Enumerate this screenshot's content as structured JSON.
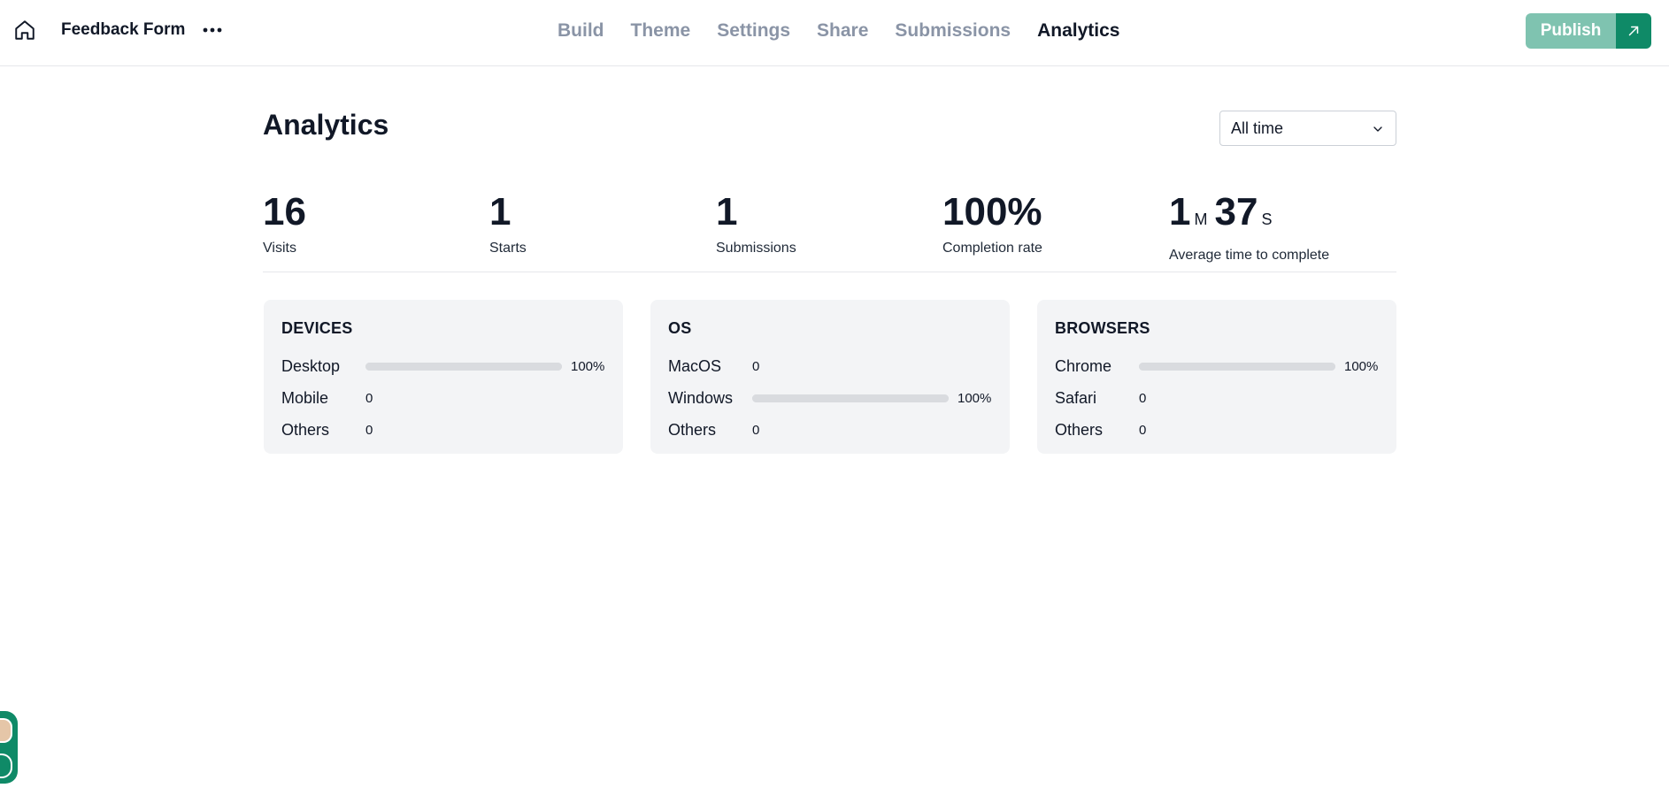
{
  "header": {
    "form_title": "Feedback Form",
    "tabs": [
      {
        "label": "Build",
        "active": false
      },
      {
        "label": "Theme",
        "active": false
      },
      {
        "label": "Settings",
        "active": false
      },
      {
        "label": "Share",
        "active": false
      },
      {
        "label": "Submissions",
        "active": false
      },
      {
        "label": "Analytics",
        "active": true
      }
    ],
    "publish_label": "Publish",
    "icons": {
      "home": "home-icon",
      "more": "more-horizontal-icon",
      "external": "arrow-up-right-icon"
    }
  },
  "main": {
    "title": "Analytics",
    "period": {
      "selected": "All time",
      "icon": "chevron-down-icon"
    },
    "stats": [
      {
        "value": "16",
        "label": "Visits"
      },
      {
        "value": "1",
        "label": "Starts"
      },
      {
        "value": "1",
        "label": "Submissions"
      },
      {
        "value": "100%",
        "label": "Completion rate"
      },
      {
        "minutes": "1",
        "minutes_unit": "M",
        "seconds": "37",
        "seconds_unit": "S",
        "label": "Average time to complete"
      }
    ],
    "cards": [
      {
        "title": "DEVICES",
        "rows": [
          {
            "label": "Desktop",
            "value": "100%",
            "fraction": 1.0
          },
          {
            "label": "Mobile",
            "value": "0",
            "fraction": 0
          },
          {
            "label": "Others",
            "value": "0",
            "fraction": 0
          }
        ]
      },
      {
        "title": "OS",
        "rows": [
          {
            "label": "MacOS",
            "value": "0",
            "fraction": 0
          },
          {
            "label": "Windows",
            "value": "100%",
            "fraction": 1.0
          },
          {
            "label": "Others",
            "value": "0",
            "fraction": 0
          }
        ]
      },
      {
        "title": "BROWSERS",
        "rows": [
          {
            "label": "Chrome",
            "value": "100%",
            "fraction": 1.0
          },
          {
            "label": "Safari",
            "value": "0",
            "fraction": 0
          },
          {
            "label": "Others",
            "value": "0",
            "fraction": 0
          }
        ]
      }
    ]
  },
  "colors": {
    "accent": "#0f8a67",
    "publish_disabled": "#7fc3b0",
    "bar_track": "#d9dbdf",
    "card_bg": "#f3f4f6"
  }
}
